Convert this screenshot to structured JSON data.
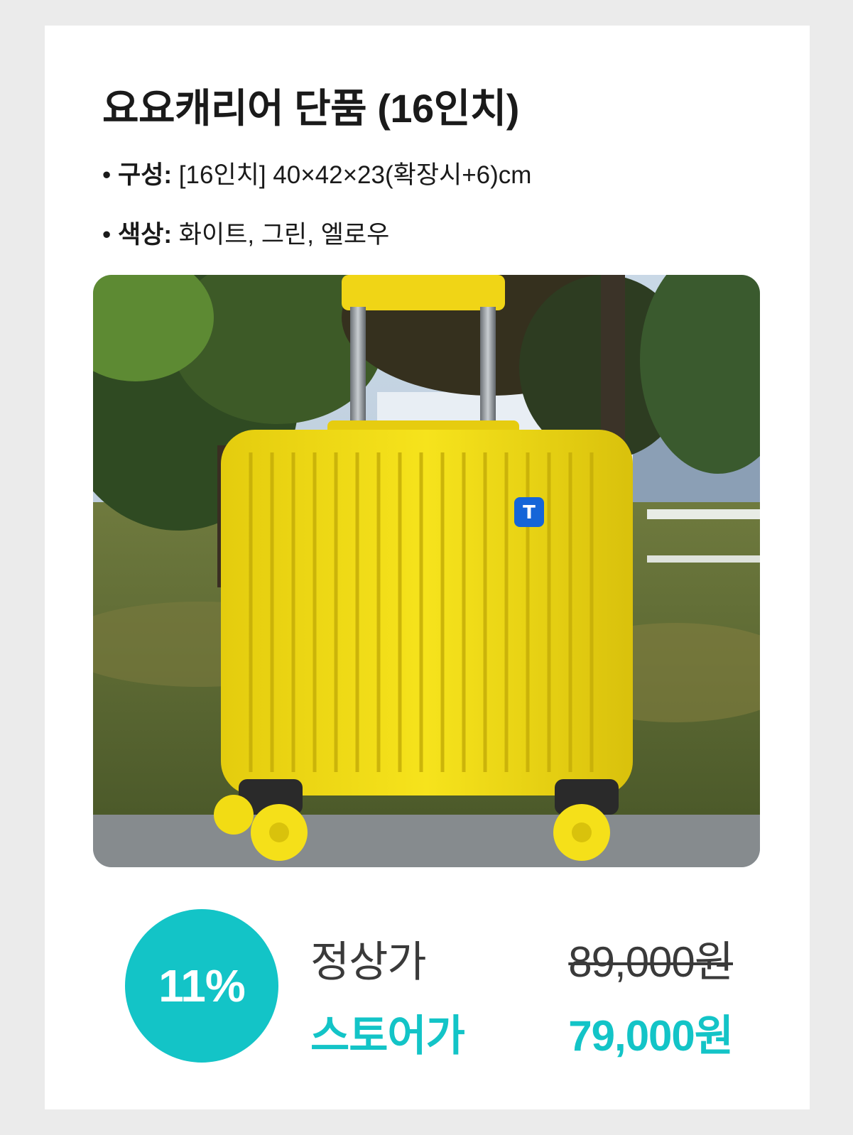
{
  "product": {
    "title": "요요캐리어 단품 (16인치)",
    "specs": [
      {
        "bullet": "•",
        "key": "구성:",
        "value": "[16인치] 40×42×23(확장시+6)cm"
      },
      {
        "bullet": "•",
        "key": "색상:",
        "value": "화이트, 그린, 엘로우"
      }
    ],
    "image": {
      "subject": "yellow suitcase",
      "logo_icon": "brand-logo-icon"
    }
  },
  "pricing": {
    "discount": "11%",
    "regular_label": "정상가",
    "regular_price": "89,000원",
    "store_label": "스토어가",
    "store_price": "79,000원"
  },
  "colors": {
    "accent": "#13c4c7",
    "text": "#1a1a1a",
    "suitcase": "#f2dc14",
    "background": "#ebebeb"
  }
}
